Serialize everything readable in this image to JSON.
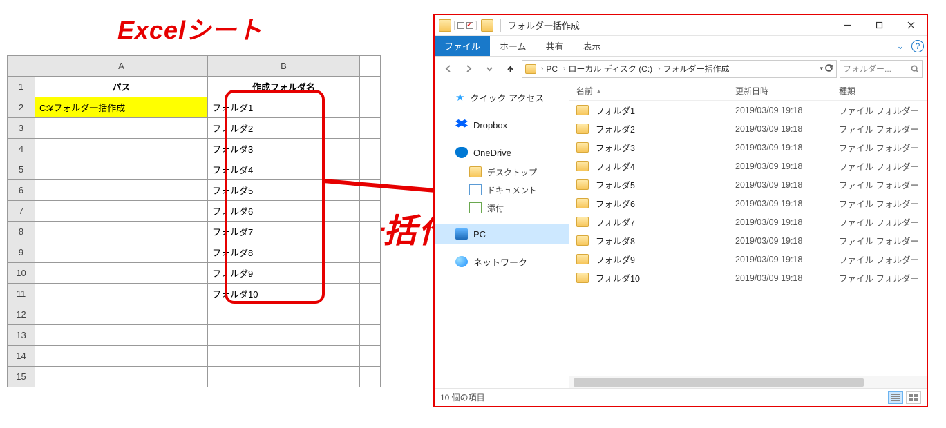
{
  "annotations": {
    "excel_title": "Excelシート",
    "bulk_label": "一括作成"
  },
  "excel": {
    "col_a_header": "A",
    "col_b_header": "B",
    "row1_a": "パス",
    "row1_b": "作成フォルダ名",
    "path_value": "C:¥フォルダ一括作成",
    "folder_names": [
      "フォルダ1",
      "フォルダ2",
      "フォルダ3",
      "フォルダ4",
      "フォルダ5",
      "フォルダ6",
      "フォルダ7",
      "フォルダ8",
      "フォルダ9",
      "フォルダ10"
    ],
    "row_numbers": [
      "1",
      "2",
      "3",
      "4",
      "5",
      "6",
      "7",
      "8",
      "9",
      "10",
      "11",
      "12",
      "13",
      "14",
      "15"
    ]
  },
  "explorer": {
    "window_title": "フォルダ一括作成",
    "tabs": {
      "file": "ファイル",
      "home": "ホーム",
      "share": "共有",
      "view": "表示"
    },
    "breadcrumb": {
      "pc": "PC",
      "drive": "ローカル ディスク (C:)",
      "folder": "フォルダ一括作成"
    },
    "search_placeholder": "フォルダー...",
    "columns": {
      "name": "名前",
      "date": "更新日時",
      "type": "種類"
    },
    "nav": {
      "quick_access": "クイック アクセス",
      "dropbox": "Dropbox",
      "onedrive": "OneDrive",
      "desktop": "デスクトップ",
      "documents": "ドキュメント",
      "pictures": "添付",
      "pc": "PC",
      "network": "ネットワーク"
    },
    "items": [
      {
        "name": "フォルダ1",
        "date": "2019/03/09 19:18",
        "type": "ファイル フォルダー"
      },
      {
        "name": "フォルダ2",
        "date": "2019/03/09 19:18",
        "type": "ファイル フォルダー"
      },
      {
        "name": "フォルダ3",
        "date": "2019/03/09 19:18",
        "type": "ファイル フォルダー"
      },
      {
        "name": "フォルダ4",
        "date": "2019/03/09 19:18",
        "type": "ファイル フォルダー"
      },
      {
        "name": "フォルダ5",
        "date": "2019/03/09 19:18",
        "type": "ファイル フォルダー"
      },
      {
        "name": "フォルダ6",
        "date": "2019/03/09 19:18",
        "type": "ファイル フォルダー"
      },
      {
        "name": "フォルダ7",
        "date": "2019/03/09 19:18",
        "type": "ファイル フォルダー"
      },
      {
        "name": "フォルダ8",
        "date": "2019/03/09 19:18",
        "type": "ファイル フォルダー"
      },
      {
        "name": "フォルダ9",
        "date": "2019/03/09 19:18",
        "type": "ファイル フォルダー"
      },
      {
        "name": "フォルダ10",
        "date": "2019/03/09 19:18",
        "type": "ファイル フォルダー"
      }
    ],
    "status": "10 個の項目"
  }
}
